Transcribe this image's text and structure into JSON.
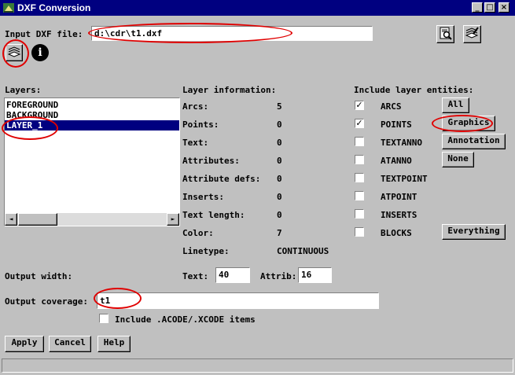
{
  "window": {
    "title": "DXF Conversion",
    "minimize": "_",
    "maximize": "□",
    "close": "×"
  },
  "input": {
    "label": "Input DXF file:",
    "value": "d:\\cdr\\t1.dxf",
    "info_glyph": "i"
  },
  "layers": {
    "label": "Layers:",
    "items": [
      "FOREGROUND",
      "BACKGROUND",
      "LAYER_1"
    ],
    "selected_index": 2
  },
  "layer_info": {
    "label": "Layer information:",
    "rows": [
      {
        "label": "Arcs:",
        "value": "5"
      },
      {
        "label": "Points:",
        "value": "0"
      },
      {
        "label": "Text:",
        "value": "0"
      },
      {
        "label": "Attributes:",
        "value": "0"
      },
      {
        "label": "Attribute defs:",
        "value": "0"
      },
      {
        "label": "Inserts:",
        "value": "0"
      },
      {
        "label": "Text length:",
        "value": "0"
      },
      {
        "label": "Color:",
        "value": "7"
      },
      {
        "label": "Linetype:",
        "value": "CONTINUOUS"
      }
    ]
  },
  "entities": {
    "label": "Include layer entities:",
    "items": [
      {
        "name": "ARCS",
        "checked": true
      },
      {
        "name": "POINTS",
        "checked": true
      },
      {
        "name": "TEXTANNO",
        "checked": false
      },
      {
        "name": "ATANNO",
        "checked": false
      },
      {
        "name": "TEXTPOINT",
        "checked": false
      },
      {
        "name": "ATPOINT",
        "checked": false
      },
      {
        "name": "INSERTS",
        "checked": false
      },
      {
        "name": "BLOCKS",
        "checked": false
      }
    ],
    "check_glyph": "✓",
    "buttons": {
      "all": "All",
      "graphics": "Graphics",
      "annotation": "Annotation",
      "none": "None",
      "everything": "Everything"
    }
  },
  "output": {
    "width_label": "Output width:",
    "text_label": "Text:",
    "text_value": "40",
    "attrib_label": "Attrib:",
    "attrib_value": "16",
    "coverage_label": "Output coverage:",
    "coverage_value": "t1",
    "include_codes_label": "Include .ACODE/.XCODE items"
  },
  "footer": {
    "apply": "Apply",
    "cancel": "Cancel",
    "help": "Help"
  },
  "scroll": {
    "left_arrow": "◄",
    "right_arrow": "►"
  },
  "colors": {
    "titlebar": "#000080",
    "face": "#c0c0c0",
    "selection": "#000080",
    "annotation_red": "#e00000"
  }
}
